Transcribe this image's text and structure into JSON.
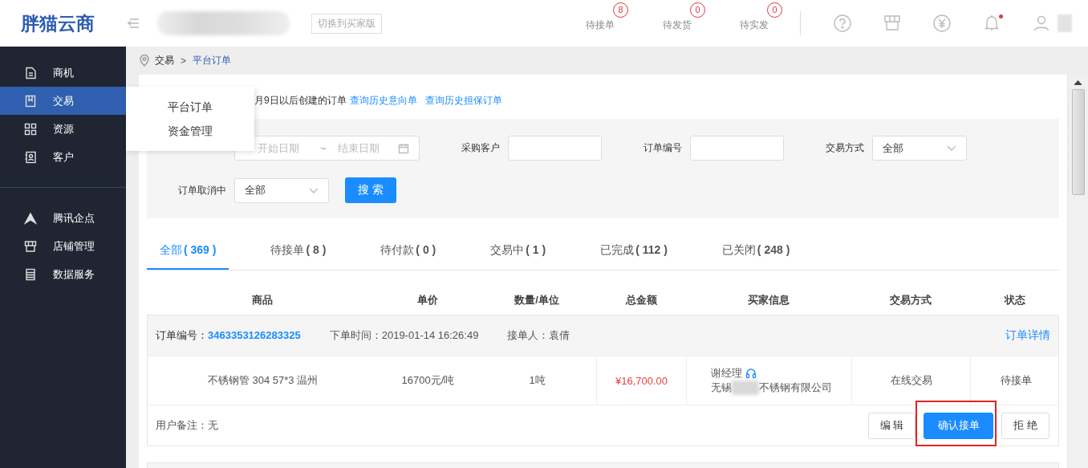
{
  "header": {
    "logo": "胖猫云商",
    "switch_button": "切换到买家版",
    "counters": [
      {
        "label": "待接单",
        "count": "8"
      },
      {
        "label": "待发货",
        "count": "0"
      },
      {
        "label": "待实发",
        "count": "0"
      }
    ],
    "icons": [
      {
        "kind": "help"
      },
      {
        "kind": "store"
      },
      {
        "kind": "yen"
      },
      {
        "kind": "bell",
        "unread": true
      },
      {
        "kind": "user"
      }
    ]
  },
  "sidebar": {
    "groups": [
      [
        {
          "label": "商机",
          "selected": false
        },
        {
          "label": "交易",
          "selected": true
        },
        {
          "label": "资源",
          "selected": false
        },
        {
          "label": "客户",
          "selected": false
        }
      ],
      [
        {
          "label": "腾讯企点",
          "selected": false
        },
        {
          "label": "店铺管理",
          "selected": false
        },
        {
          "label": "数据服务",
          "selected": false
        }
      ]
    ]
  },
  "flyout_menu": {
    "items": [
      "平台订单",
      "资金管理"
    ]
  },
  "breadcrumb": {
    "items": [
      "交易",
      "平台订单"
    ],
    "separator": ">"
  },
  "notice": {
    "text": "月9日以后创建的订单",
    "links": [
      "查询历史意向单",
      "查询历史担保订单"
    ]
  },
  "filters": [
    [
      {
        "kind": "daterange",
        "start_placeholder": "开始日期",
        "separator": "~",
        "end_placeholder": "结束日期"
      },
      {
        "kind": "text",
        "label": "采购客户"
      },
      {
        "kind": "text",
        "label": "订单编号"
      },
      {
        "kind": "select",
        "label": "交易方式",
        "value": "全部"
      }
    ],
    [
      {
        "kind": "select",
        "label": "订单取消中",
        "value": "全部"
      },
      {
        "kind": "button",
        "label": "搜 索"
      }
    ]
  ],
  "tabs": [
    {
      "label": "全部",
      "count": "( 369 )",
      "selected": true
    },
    {
      "label": "待接单",
      "count": "( 8 )",
      "selected": false
    },
    {
      "label": "待付款",
      "count": "( 0 )",
      "selected": false
    },
    {
      "label": "交易中",
      "count": "( 1 )",
      "selected": false
    },
    {
      "label": "已完成",
      "count": "( 112 )",
      "selected": false
    },
    {
      "label": "已关闭",
      "count": "( 248 )",
      "selected": false
    }
  ],
  "table": {
    "columns": [
      "商品",
      "单价",
      "数量/单位",
      "总金额",
      "买家信息",
      "交易方式",
      "状态"
    ],
    "orders": [
      {
        "order_no_label": "订单编号：",
        "order_no": "3463353126283325",
        "time": "下单时间：2019-01-14 16:26:49",
        "receiver": "接单人：袁倩",
        "detail_link": "订单详情",
        "items": [
          {
            "product": "不锈钢管 304 57*3 温州",
            "price": "16700元/吨",
            "quantity": "1吨",
            "total": "¥16,700.00",
            "buyer_name": "谢经理",
            "buyer_company": [
              "无锡",
              "不锈钢有限公司"
            ],
            "trade_method": "在线交易",
            "status": "待接单"
          }
        ],
        "remark": "用户备注：无",
        "actions": [
          {
            "label": "编 辑",
            "kind": "default",
            "highlighted": false
          },
          {
            "label": "确认接单",
            "kind": "primary",
            "highlighted": true
          },
          {
            "label": "拒 绝",
            "kind": "default",
            "highlighted": false
          }
        ]
      }
    ],
    "next_order_peek": true
  }
}
